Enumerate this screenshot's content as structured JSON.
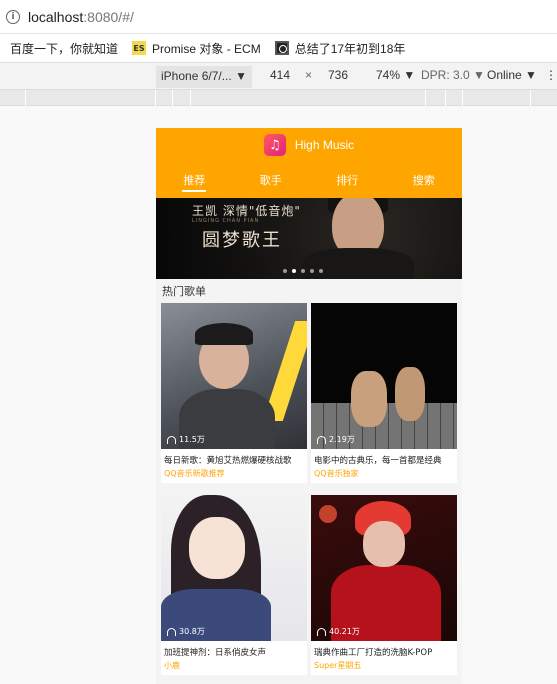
{
  "browser": {
    "url_host": "localhost",
    "url_rest": ":8080/#/",
    "bookmarks": [
      {
        "label": "百度一下，你就知道",
        "icon": "none"
      },
      {
        "label": "Promise 对象 - ECM",
        "icon": "es-badge-icon",
        "badge": "ES"
      },
      {
        "label": "总结了17年初到18年",
        "icon": "film-icon"
      }
    ]
  },
  "devtools": {
    "device": "iPhone 6/7/...",
    "width": "414",
    "times": "×",
    "height": "736",
    "zoom": "74%",
    "dpr": "DPR: 3.0",
    "network": "Online"
  },
  "app": {
    "title": "High Music",
    "tabs": [
      "推荐",
      "歌手",
      "排行",
      "搜索"
    ],
    "active_tab": 0,
    "banner": {
      "line1": "王凯   深情\"低音炮\"",
      "line2": "LINGING CHAN PIAN",
      "line3": "圆梦歌王",
      "slides": 5,
      "active_slide": 1
    },
    "section_title": "热门歌单",
    "playlists": [
      {
        "plays": "11.5万",
        "title": "每日新歌：黄旭艾热燃爆硬核战歌",
        "author": "QQ音乐新歌推荐"
      },
      {
        "plays": "2.19万",
        "title": "电影中的古典乐，每一首都是经典",
        "author": "QQ音乐独家"
      },
      {
        "plays": "30.8万",
        "title": "加班提神剂：日系俏皮女声",
        "author": "小鹿"
      },
      {
        "plays": "40.21万",
        "title": "瑞典作曲工厂打造的洗脑K-POP",
        "author": "Super星期五"
      }
    ]
  },
  "colors": {
    "accent": "#ffa500"
  }
}
